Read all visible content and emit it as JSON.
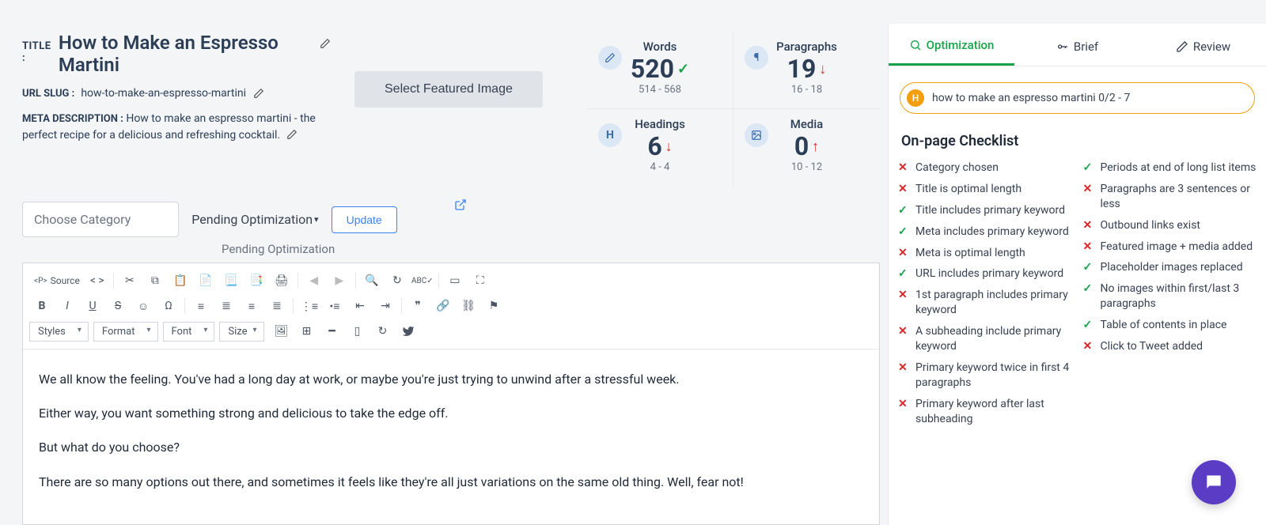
{
  "title": {
    "label": "TITLE :",
    "value": "How to Make an Espresso Martini"
  },
  "slug": {
    "label": "URL SLUG :",
    "value": "how-to-make-an-espresso-martini"
  },
  "meta": {
    "label": "META DESCRIPTION :",
    "value": "How to make an espresso martini - the perfect recipe for a delicious and refreshing cocktail."
  },
  "featured_button": "Select Featured Image",
  "stats": {
    "words": {
      "label": "Words",
      "value": "520",
      "range": "514 - 568",
      "status": "ok"
    },
    "paragraphs": {
      "label": "Paragraphs",
      "value": "19",
      "range": "16 - 18",
      "status": "bad"
    },
    "headings": {
      "label": "Headings",
      "value": "6",
      "range": "4 - 4",
      "status": "bad"
    },
    "media": {
      "label": "Media",
      "value": "0",
      "range": "10 - 12",
      "status": "up"
    }
  },
  "controls": {
    "category_placeholder": "Choose Category",
    "status": "Pending Optimization",
    "status_sub": "Pending Optimization",
    "update": "Update"
  },
  "toolbar": {
    "source": "Source",
    "styles": "Styles",
    "format": "Format",
    "font": "Font",
    "size": "Size"
  },
  "content": {
    "p1": "We all know the feeling. You've had a long day at work, or maybe you're just trying to unwind after a stressful week.",
    "p2": "Either way, you want something strong and delicious to take the edge off.",
    "p3": "But what do you choose?",
    "p4": "There are so many options out there, and sometimes it feels like they're all just variations on the same old thing. Well, fear not!"
  },
  "tabs": {
    "optimization": "Optimization",
    "brief": "Brief",
    "review": "Review"
  },
  "keyword": {
    "badge": "H",
    "text": "how to make an espresso martini 0/2 - 7"
  },
  "checklist_title": "On-page Checklist",
  "checklist_left": [
    {
      "ok": false,
      "text": "Category chosen"
    },
    {
      "ok": false,
      "text": "Title is optimal length"
    },
    {
      "ok": true,
      "text": "Title includes primary keyword"
    },
    {
      "ok": true,
      "text": "Meta includes primary keyword"
    },
    {
      "ok": false,
      "text": "Meta is optimal length"
    },
    {
      "ok": true,
      "text": "URL includes primary keyword"
    },
    {
      "ok": false,
      "text": "1st paragraph includes primary keyword"
    },
    {
      "ok": false,
      "text": "A subheading include primary keyword"
    },
    {
      "ok": false,
      "text": "Primary keyword twice in first 4 paragraphs"
    },
    {
      "ok": false,
      "text": "Primary keyword after last subheading"
    }
  ],
  "checklist_right": [
    {
      "ok": true,
      "text": "Periods at end of long list items"
    },
    {
      "ok": false,
      "text": "Paragraphs are 3 sentences or less"
    },
    {
      "ok": false,
      "text": "Outbound links exist"
    },
    {
      "ok": false,
      "text": "Featured image + media added"
    },
    {
      "ok": true,
      "text": "Placeholder images replaced"
    },
    {
      "ok": true,
      "text": "No images within first/last 3 paragraphs"
    },
    {
      "ok": true,
      "text": "Table of contents in place"
    },
    {
      "ok": false,
      "text": "Click to Tweet added"
    }
  ]
}
